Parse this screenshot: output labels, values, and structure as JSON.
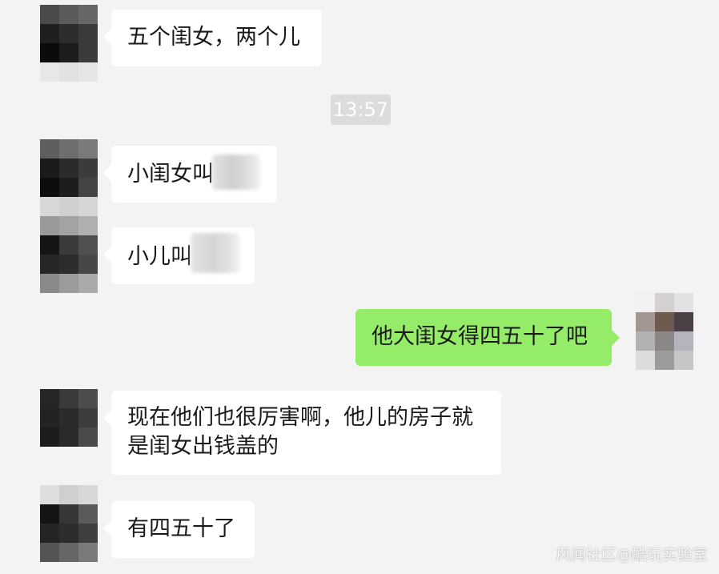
{
  "messages": [
    {
      "side": "left",
      "text": "五个闺女，两个儿"
    },
    {
      "side": "left",
      "text": "小闺女叫"
    },
    {
      "side": "left",
      "text": "小儿叫"
    },
    {
      "side": "right",
      "text": "他大闺女得四五十了吧"
    },
    {
      "side": "left",
      "line1": "现在他们也很厉害啊，他儿的房子就",
      "line2": "是闺女出钱盖的"
    },
    {
      "side": "left",
      "text": "有四五十了"
    }
  ],
  "timestamp": "13:57",
  "watermark": "风闻社区@酷玩实验室",
  "colors": {
    "background": "#f3f3f3",
    "bubble_left": "#ffffff",
    "bubble_right": "#95ec69",
    "timestamp_bg": "#dcdcdc"
  },
  "avatars": {
    "a1": [
      "#4a4a4a",
      "#5b5b5b",
      "#676767",
      "#1f1f1f",
      "#2d2d2d",
      "#3a3a3a",
      "#0b0b0b",
      "#1c1c1c",
      "#3b3b3b",
      "#e8e8e8",
      "#e2e2e2",
      "#e6e6e6"
    ],
    "a2": [
      "#5e5e5e",
      "#6e6e6e",
      "#7a7a7a",
      "#1b1b1b",
      "#2b2b2b",
      "#3b3b3b",
      "#0c0c0c",
      "#1d1d1d",
      "#444444",
      "#d8d8d8",
      "#cfcfcf",
      "#d6d6d6"
    ],
    "a3": [
      "#9a9a9a",
      "#a3a3a3",
      "#b0b0b0",
      "#151515",
      "#3a3a3a",
      "#505050",
      "#262626",
      "#2c2c2c",
      "#474747",
      "#8a8a8a",
      "#9b9b9b",
      "#aaaaaa"
    ],
    "a4": [
      "#f1f1f1",
      "#d5d0d0",
      "#e2e2e2",
      "#a39891",
      "#6e5a4e",
      "#4c4047",
      "#b3b1b1",
      "#8c8787",
      "#b5b3bb",
      "#dcdcdc",
      "#9b9b9b",
      "#c6c6c6"
    ],
    "a5": [
      "#262626",
      "#3a3a3a",
      "#4c4c4c",
      "#232323",
      "#2b2b2b",
      "#3c3c3c",
      "#1c1c1c",
      "#2a2a2a",
      "#4a4a4a",
      "#f3f3f3",
      "#f3f3f3",
      "#f3f3f3"
    ],
    "a6": [
      "#dedede",
      "#cfcfcf",
      "#d8d8d8",
      "#141414",
      "#363636",
      "#5a5a5a",
      "#242424",
      "#2d2d2d",
      "#3e3e3e",
      "#555555",
      "#666666",
      "#7a7a7a"
    ]
  }
}
